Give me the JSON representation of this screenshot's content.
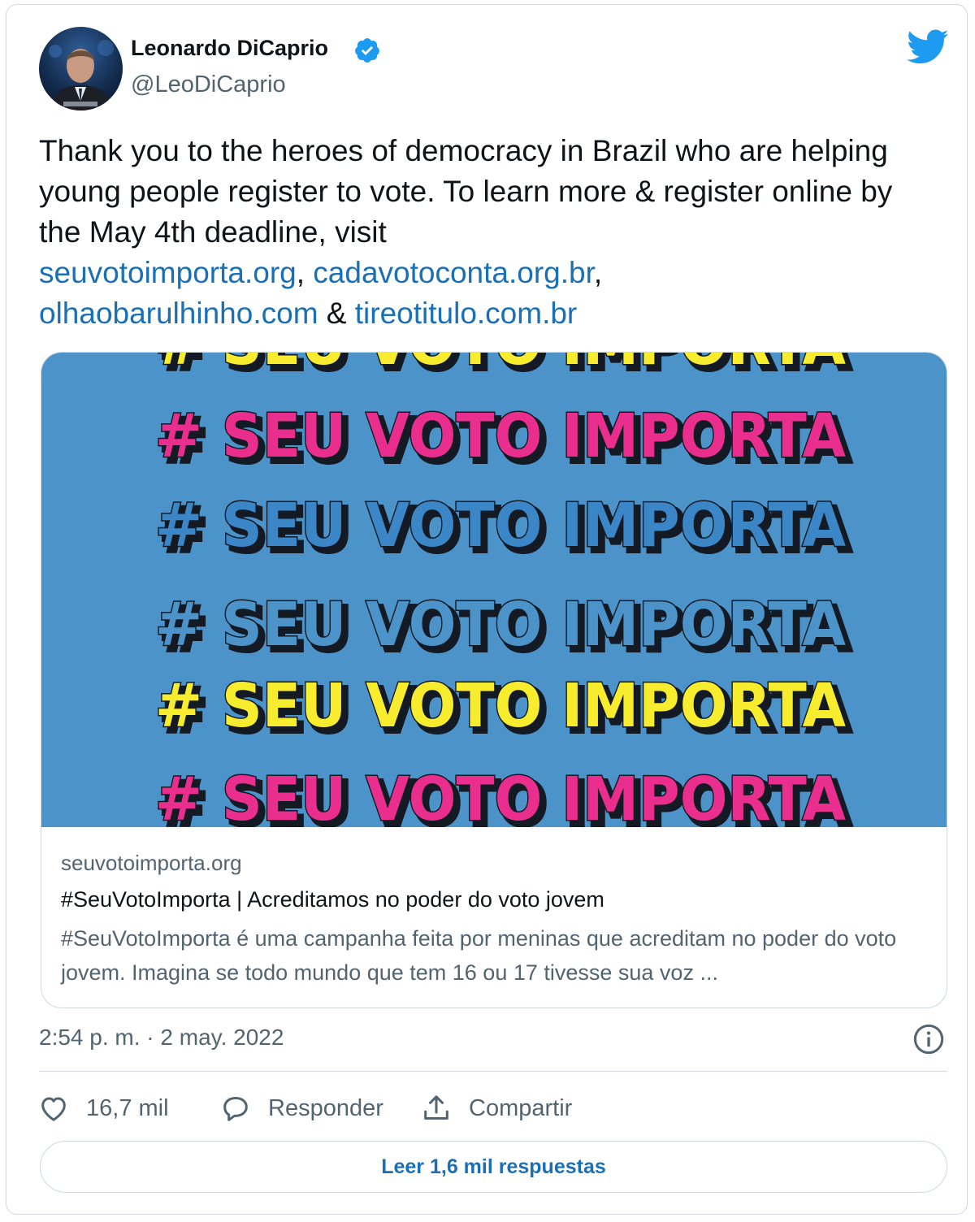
{
  "author": {
    "name": "Leonardo DiCaprio",
    "handle": "@LeoDiCaprio",
    "verified": true
  },
  "tweet": {
    "text_intro": "Thank you to the heroes of democracy in Brazil who are helping young people register to vote. To learn more & register online by the May 4th deadline, visit",
    "links": [
      "seuvotoimporta.org",
      "cadavotoconta.org.br",
      "olhaobarulhinho.com",
      "tireotitulo.com.br"
    ],
    "sep_comma": ",",
    "sep_amp": "&"
  },
  "media": {
    "banner_text": "# SEU VOTO IMPORTA",
    "rows": [
      {
        "fill": "#f7ec2d"
      },
      {
        "fill": "#ea2e8d"
      },
      {
        "fill": "#3a86c6"
      },
      {
        "fill": "#4b93c8"
      },
      {
        "fill": "#f7ec2d"
      },
      {
        "fill": "#ea2e8d"
      }
    ],
    "background": "#4b93c8"
  },
  "link_card": {
    "domain": "seuvotoimporta.org",
    "title": "#SeuVotoImporta | Acreditamos no poder do voto jovem",
    "description": "#SeuVotoImporta é uma campanha feita por meninas que acreditam no poder do voto jovem. Imagina se todo mundo que tem 16 ou 17 tivesse sua voz ..."
  },
  "timestamp": "2:54 p. m. · 2 may. 2022",
  "actions": {
    "likes": "16,7 mil",
    "reply": "Responder",
    "share": "Compartir"
  },
  "read_replies": "Leer 1,6 mil respuestas",
  "icons": [
    "verified-badge-icon",
    "twitter-bird-icon",
    "info-icon",
    "heart-icon",
    "comment-icon",
    "share-icon"
  ],
  "colors": {
    "link": "#1b6fb4",
    "secondary_text": "#536471",
    "twitter_blue": "#1d9bf0",
    "border": "#cfd9de"
  }
}
